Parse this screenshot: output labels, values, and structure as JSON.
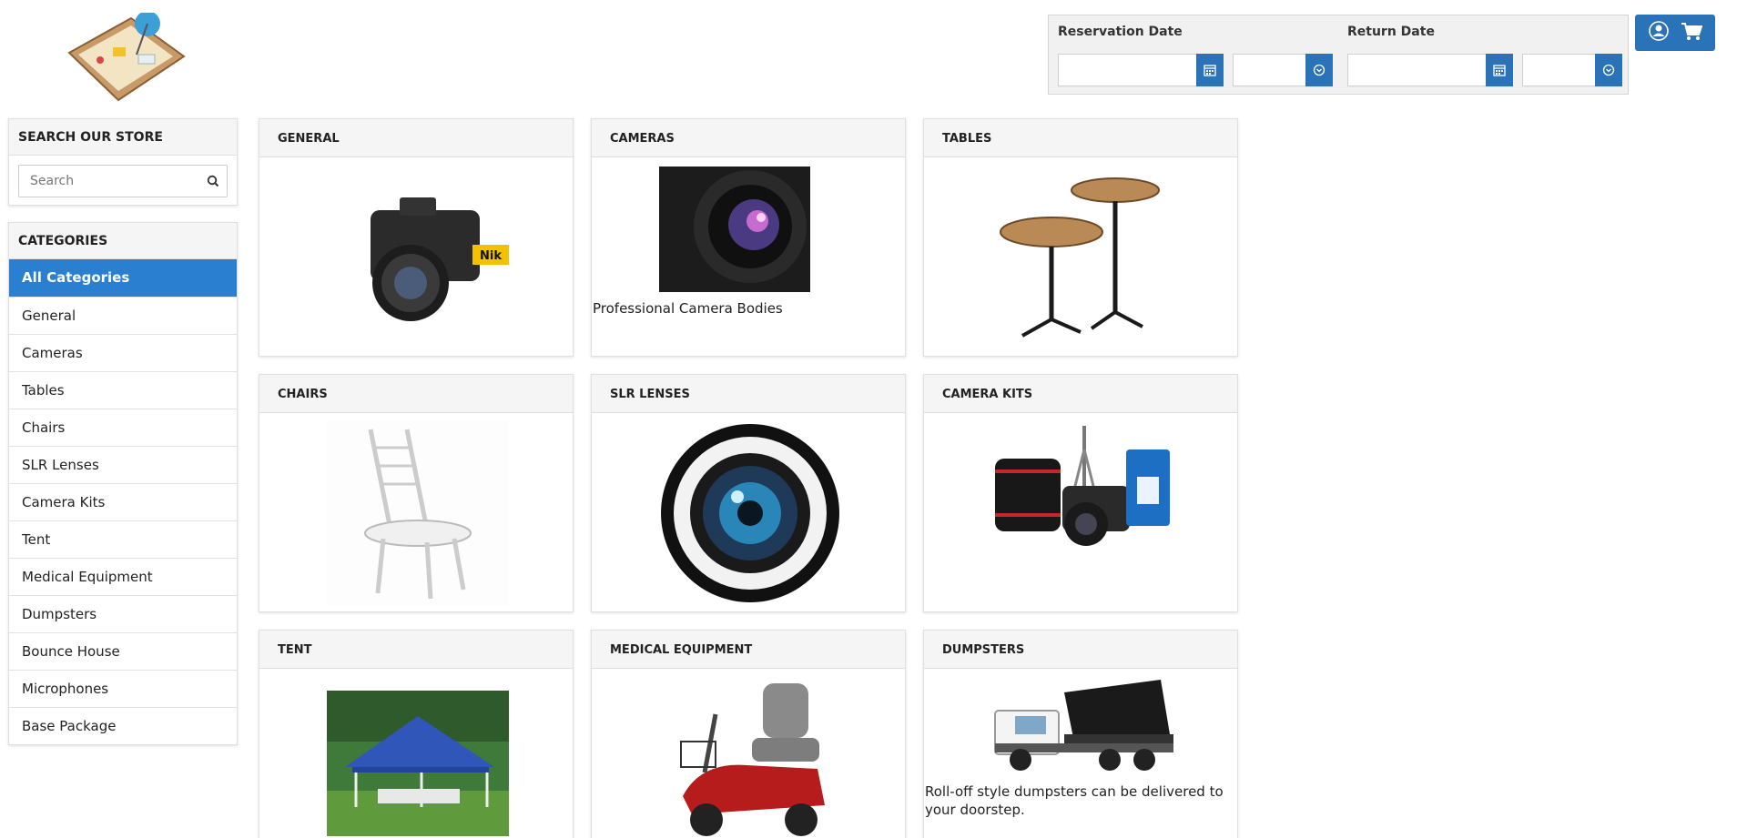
{
  "header": {
    "reservation_label": "Reservation Date",
    "return_label": "Return Date",
    "reservation_date_value": "",
    "reservation_time_value": "",
    "return_date_value": "",
    "return_time_value": ""
  },
  "search": {
    "title": "SEARCH OUR STORE",
    "placeholder": "Search"
  },
  "categories": {
    "title": "CATEGORIES",
    "items": [
      "All Categories",
      "General",
      "Cameras",
      "Tables",
      "Chairs",
      "SLR Lenses",
      "Camera Kits",
      "Tent",
      "Medical Equipment",
      "Dumpsters",
      "Bounce House",
      "Microphones",
      "Base Package"
    ]
  },
  "cards": [
    {
      "title": "GENERAL",
      "description": "",
      "image": "camera-photo"
    },
    {
      "title": "CAMERAS",
      "description": "Professional Camera Bodies",
      "image": "camera-lens-closeup-photo"
    },
    {
      "title": "TABLES",
      "description": "",
      "image": "cocktail-tables-photo"
    },
    {
      "title": "CHAIRS",
      "description": "",
      "image": "chiavari-chair-photo"
    },
    {
      "title": "SLR LENSES",
      "description": "",
      "image": "slr-lens-photo"
    },
    {
      "title": "CAMERA KITS",
      "description": "",
      "image": "camera-kit-photo"
    },
    {
      "title": "TENT",
      "description": "",
      "image": "tent-photo"
    },
    {
      "title": "MEDICAL EQUIPMENT",
      "description": "",
      "image": "mobility-scooter-photo"
    },
    {
      "title": "DUMPSTERS",
      "description": "Roll-off style dumpsters can be delivered to your doorstep.",
      "image": "dumpster-truck-photo"
    }
  ],
  "colors": {
    "accent": "#2a73b8",
    "active_category": "#2a7fd0",
    "panel_header": "#f5f5f5"
  }
}
